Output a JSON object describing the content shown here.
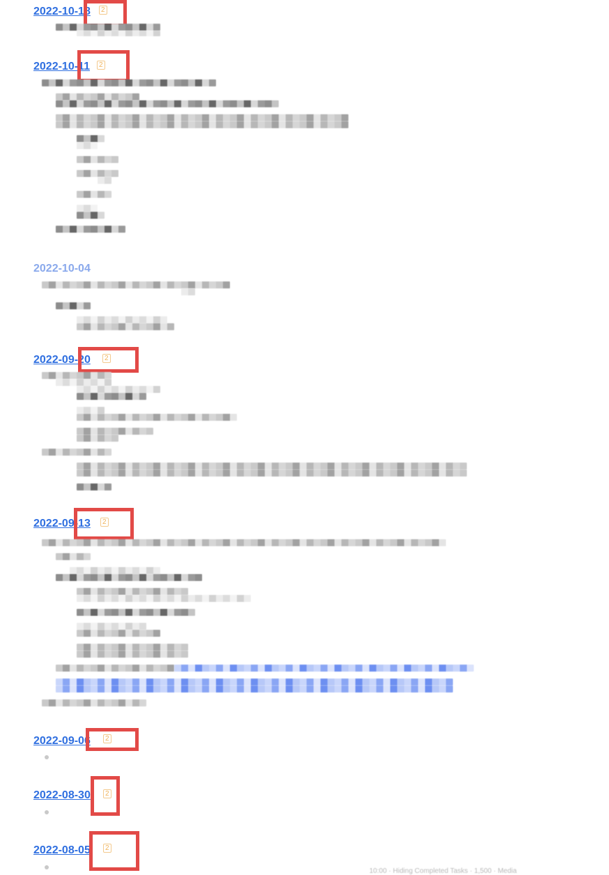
{
  "entries": [
    {
      "date": "2022-10-18",
      "badge": "2"
    },
    {
      "date": "2022-10-11",
      "badge": "2"
    },
    {
      "date": "2022-10-04",
      "badge": ""
    },
    {
      "date": "2022-09-20",
      "badge": "2"
    },
    {
      "date": "2022-09-13",
      "badge": "2"
    },
    {
      "date": "2022-09-06",
      "badge": "2"
    },
    {
      "date": "2022-08-30",
      "badge": "2"
    },
    {
      "date": "2022-08-05",
      "badge": "2"
    }
  ],
  "colors": {
    "link": "#2f6fe0",
    "highlight": "#e24a47",
    "badge": "#f0b35a"
  },
  "footer": {
    "text": "10:00 · Hiding Completed Tasks · 1,500 · Media"
  }
}
